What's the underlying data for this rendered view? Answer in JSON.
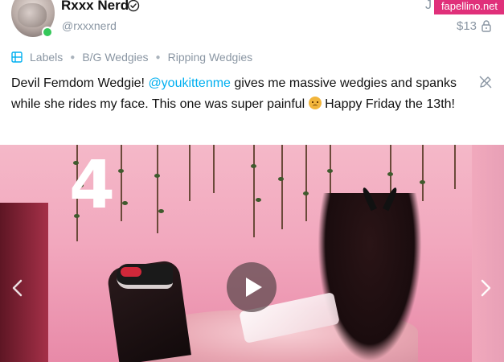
{
  "header": {
    "username": "Rxxx Nerd",
    "handle": "@rxxxnerd",
    "truncated_letter": "J",
    "watermark": "fapellino.net",
    "price": "$13"
  },
  "labels": {
    "title": "Labels",
    "items": [
      "B/G Wedgies",
      "Ripping Wedgies"
    ]
  },
  "post": {
    "text_before": "Devil Femdom Wedgie! ",
    "mention": "@youkittenme",
    "text_after": " gives me massive wedgies and spanks while she rides my face. This one was super painful ",
    "text_end": " Happy Friday the 13th!"
  },
  "media": {
    "overlay_number": "4"
  },
  "icons": {
    "verified": "verified-badge-icon",
    "lock": "lock-icon",
    "labels": "labels-icon",
    "edit": "edit-icon",
    "play": "play-icon",
    "prev": "chevron-left-icon",
    "next": "chevron-right-icon"
  },
  "colors": {
    "accent": "#00aff0",
    "muted": "#8a96a3",
    "online": "#34c759",
    "watermark": "#e0307a"
  }
}
